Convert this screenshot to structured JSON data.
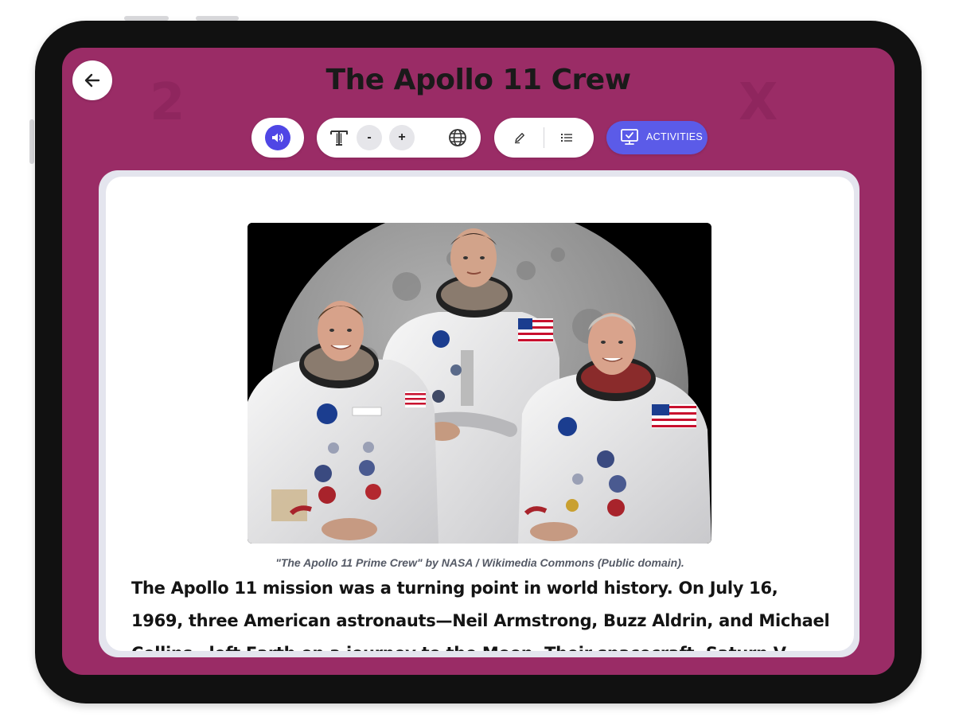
{
  "header": {
    "title": "The Apollo 11 Crew"
  },
  "toolbar": {
    "text_decrease_label": "-",
    "text_increase_label": "+",
    "activities_label": "ACTIVITIES"
  },
  "article": {
    "image_caption": "\"The Apollo 11 Prime Crew\" by NASA / Wikimedia Commons (Public domain).",
    "paragraph": "The Apollo 11 mission was a turning point in world history. On July 16, 1969, three American astronauts—Neil Armstrong, Buzz Aldrin, and Michael Collins—left Earth on a journey to the Moon. Their spacecraft, Saturn V, launched from Kennedy"
  },
  "theme": {
    "background": "#9a2c66",
    "accent": "#4f46e5",
    "activities": "#5b5be8"
  },
  "icons": [
    "back-arrow-icon",
    "speaker-icon",
    "text-size-icon",
    "globe-icon",
    "pencil-icon",
    "list-icon",
    "monitor-check-icon"
  ]
}
